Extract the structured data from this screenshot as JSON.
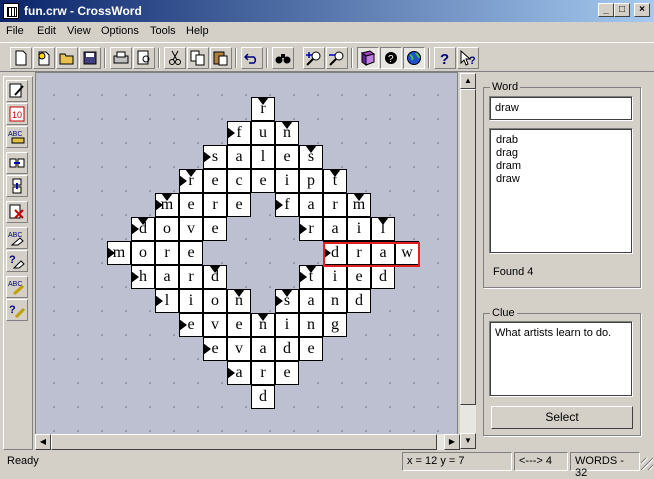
{
  "window": {
    "title": "fun.crw - CrossWord",
    "controls": [
      "_",
      "□",
      "×"
    ]
  },
  "menu": [
    "File",
    "Edit",
    "View",
    "Options",
    "Tools",
    "Help"
  ],
  "toolbar": {
    "buttons": [
      "new-icon",
      "new-from-template-icon",
      "open-icon",
      "save-icon",
      "print-icon",
      "print-preview-icon",
      "cut-icon",
      "copy-icon",
      "paste-icon",
      "undo-icon",
      "find-icon",
      "zoom-in-icon",
      "zoom-out-icon",
      "dictionary-icon",
      "hint-icon",
      "globe-icon",
      "help-icon",
      "context-help-icon"
    ]
  },
  "left_toolbar": {
    "buttons": [
      "edit-grid-icon",
      "numbering-icon",
      "abc-key-icon",
      "fit-across-icon",
      "fit-down-icon",
      "delete-word-icon",
      "abc-eraser-icon",
      "question-eraser-icon",
      "abc-pen-icon",
      "question-pen-icon"
    ]
  },
  "grid": {
    "rows": [
      [
        "r"
      ],
      [
        "f",
        "u",
        "n"
      ],
      [
        "s",
        "a",
        "l",
        "e",
        "s"
      ],
      [
        "r",
        "e",
        "c",
        "e",
        "i",
        "p",
        "t"
      ],
      [
        "m",
        "e",
        "r",
        "e",
        "f",
        "a",
        "r",
        "m"
      ],
      [
        "d",
        "o",
        "v",
        "e",
        "r",
        "a",
        "i",
        "l"
      ],
      [
        "m",
        "o",
        "r",
        "e",
        "d",
        "r",
        "a",
        "w"
      ],
      [
        "h",
        "a",
        "r",
        "d",
        "t",
        "i",
        "e",
        "d"
      ],
      [
        "l",
        "i",
        "o",
        "n",
        "s",
        "a",
        "n",
        "d"
      ],
      [
        "e",
        "v",
        "e",
        "n",
        "i",
        "n",
        "g"
      ],
      [
        "e",
        "v",
        "a",
        "d",
        "e"
      ],
      [
        "a",
        "r",
        "e"
      ],
      [
        "d"
      ]
    ]
  },
  "word_panel": {
    "label": "Word",
    "input_value": "draw",
    "matches": [
      "drab",
      "drag",
      "dram",
      "draw"
    ],
    "found_text": "Found 4"
  },
  "clue_panel": {
    "label": "Clue",
    "text": "What artists learn to do.",
    "select_button": "Select"
  },
  "status": {
    "ready": "Ready",
    "coords": "x = 12  y = 7",
    "direction": "<---> 4",
    "words": "WORDS - 32"
  }
}
